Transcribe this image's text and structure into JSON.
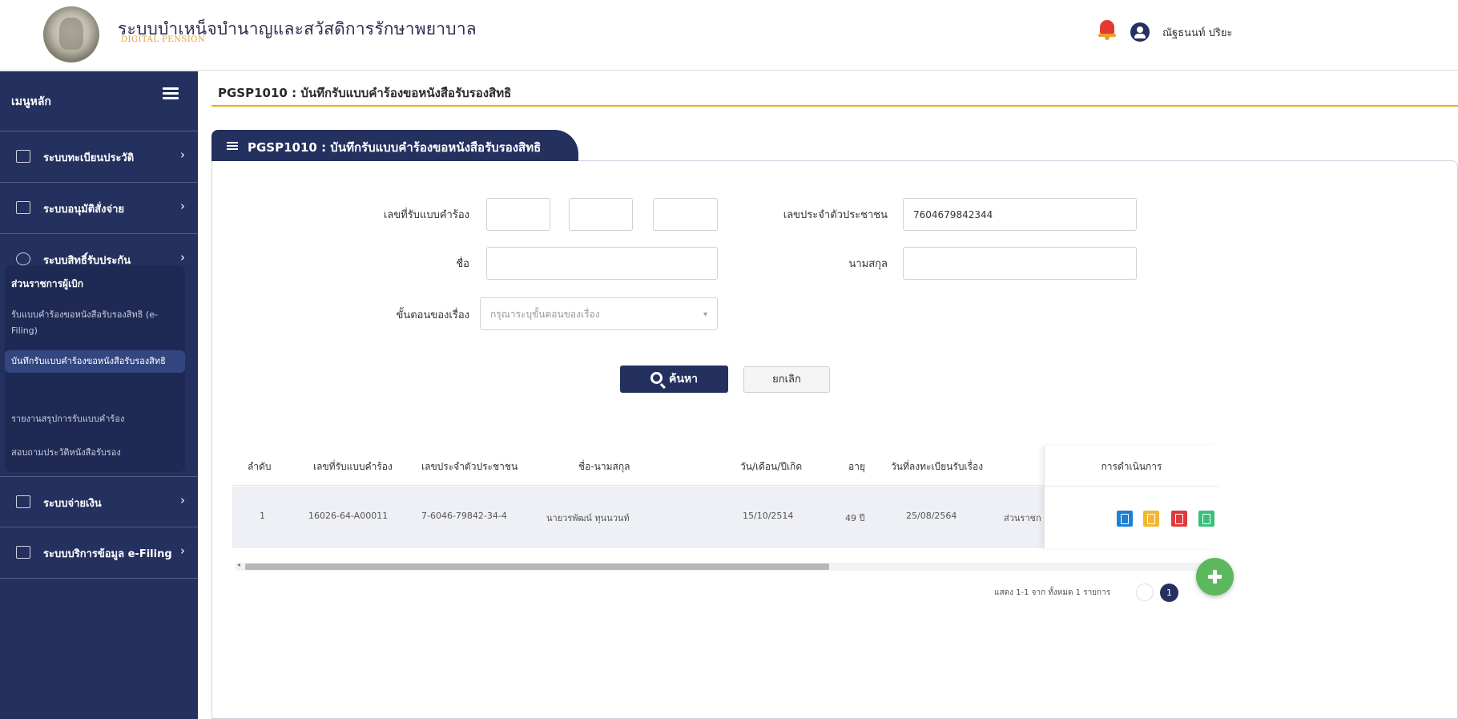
{
  "header": {
    "app_title": "ระบบบำเหน็จบำนาญและสวัสดิการรักษาพยาบาล",
    "app_subtitle": "DIGITAL PENSION",
    "user_name": "ณัฐธนนท์ ปริยะ"
  },
  "sidebar": {
    "title": "เมนูหลัก",
    "items": [
      {
        "label": "ระบบทะเบียนประวัติ",
        "icon": "id-card-icon"
      },
      {
        "label": "ระบบอนุมัติสั่งจ่าย",
        "icon": "calendar-icon"
      },
      {
        "label": "ระบบสิทธิ์รับประกัน",
        "icon": "hand-icon"
      },
      {
        "label": "ระบบจ่ายเงิน",
        "icon": "money-icon"
      },
      {
        "label": "ระบบบริการข้อมูล e-Filing",
        "icon": "document-icon"
      }
    ],
    "submenu": {
      "heading": "ส่วนราชการผู้เบิก",
      "items": [
        "รับแบบคำร้องขอหนังสือรับรองสิทธิ (e-Filing)",
        "บันทึกรับแบบคำร้องขอหนังสือรับรองสิทธิ",
        "รายงานสรุปการรับแบบคำร้อง",
        "สอบถามประวัติหนังสือรับรอง"
      ],
      "active_index": 1
    }
  },
  "page": {
    "heading": "PGSP1010 : บันทึกรับแบบคำร้องขอหนังสือรับรองสิทธิ",
    "panel_title": "PGSP1010 : บันทึกรับแบบคำร้องขอหนังสือรับรองสิทธิ"
  },
  "form": {
    "request_no_label": "เลขที่รับแบบคำร้อง",
    "citizen_id_label": "เลขประจำตัวประชาชน",
    "citizen_id_value": "7604679842344",
    "first_name_label": "ชื่อ",
    "last_name_label": "นามสกุล",
    "status_label": "ขั้นตอนของเรื่อง",
    "status_placeholder": "กรุณาระบุขั้นตอนของเรื่อง",
    "search_label": "ค้นหา",
    "cancel_label": "ยกเลิก"
  },
  "table": {
    "columns": [
      "ลำดับ",
      "เลขที่รับแบบคำร้อง",
      "เลขประจำตัวประชาชน",
      "ชื่อ-นามสกุล",
      "วัน/เดือน/ปีเกิด",
      "อายุ",
      "วันที่ลงทะเบียนรับเรื่อง",
      "การดำเนินการ"
    ],
    "rows": [
      {
        "no": "1",
        "request_no": "16026-64-A00011",
        "citizen_id": "7-6046-79842-34-4",
        "name": "นายวรพัฒน์ ทุนนวนท์",
        "dob": "15/10/2514",
        "age": "49 ปี",
        "reg_date": "25/08/2564",
        "agency": "ส่วนราชก"
      }
    ],
    "actions": [
      {
        "icon": "view-document-icon",
        "color": "#1e7fd6"
      },
      {
        "icon": "edit-icon",
        "color": "#f4b531"
      },
      {
        "icon": "delete-icon",
        "color": "#e13a3a"
      },
      {
        "icon": "download-icon",
        "color": "#3bbf7a"
      }
    ]
  },
  "pagination": {
    "summary": "แสดง 1-1 จาก ทั้งหมด 1 รายการ",
    "current_page": "1"
  },
  "colors": {
    "primary": "#24305e",
    "accent": "#e8b010",
    "fab": "#5cb85c"
  }
}
